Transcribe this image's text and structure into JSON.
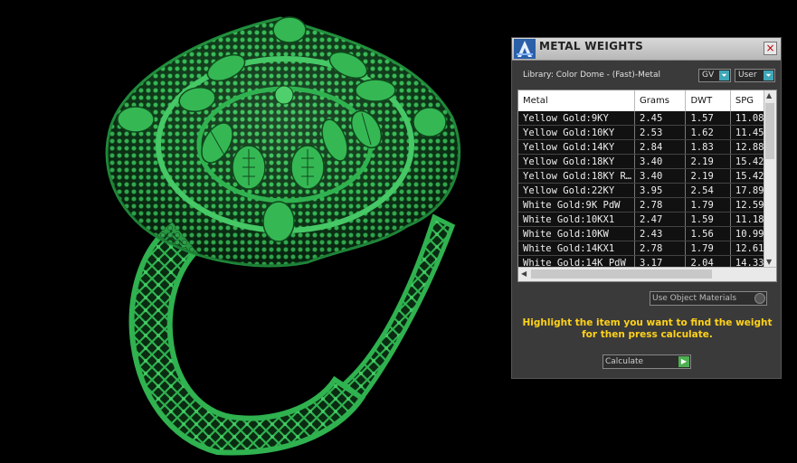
{
  "panel": {
    "title": "METAL WEIGHTS",
    "close_glyph": "×",
    "library_label": "Library: Color Dome - (Fast)-Metal",
    "gv_combo": "GV",
    "user_combo": "User",
    "use_object_materials": "Use Object Materials",
    "instruction_line1": "Highlight the item you want to find the weight",
    "instruction_line2": "for then press calculate.",
    "calculate_label": "Calculate"
  },
  "table": {
    "headers": [
      "Metal",
      "Grams",
      "DWT",
      "SPG"
    ],
    "rows": [
      [
        "Yellow Gold:9KY",
        "2.45",
        "1.57",
        "11.08"
      ],
      [
        "Yellow Gold:10KY",
        "2.53",
        "1.62",
        "11.45"
      ],
      [
        "Yellow Gold:14KY",
        "2.84",
        "1.83",
        "12.88"
      ],
      [
        "Yellow Gold:18KY",
        "3.40",
        "2.19",
        "15.42"
      ],
      [
        "Yellow Gold:18KY R…",
        "3.40",
        "2.19",
        "15.42"
      ],
      [
        "Yellow Gold:22KY",
        "3.95",
        "2.54",
        "17.89"
      ],
      [
        "White Gold:9K PdW",
        "2.78",
        "1.79",
        "12.59"
      ],
      [
        "White Gold:10KX1",
        "2.47",
        "1.59",
        "11.18"
      ],
      [
        "White Gold:10KW",
        "2.43",
        "1.56",
        "10.99"
      ],
      [
        "White Gold:14KX1",
        "2.78",
        "1.79",
        "12.61"
      ],
      [
        "White Gold:14K PdW",
        "3.17",
        "2.04",
        "14.33"
      ]
    ]
  },
  "icons": {
    "logo": "app-logo-icon",
    "close": "close-icon",
    "dropdown": "chevron-down-icon",
    "go": "play-arrow-icon"
  },
  "colors": {
    "ring_green": "#2fb24f",
    "instruction_yellow": "#ffd21a",
    "panel_bg": "#3a3a3a"
  }
}
